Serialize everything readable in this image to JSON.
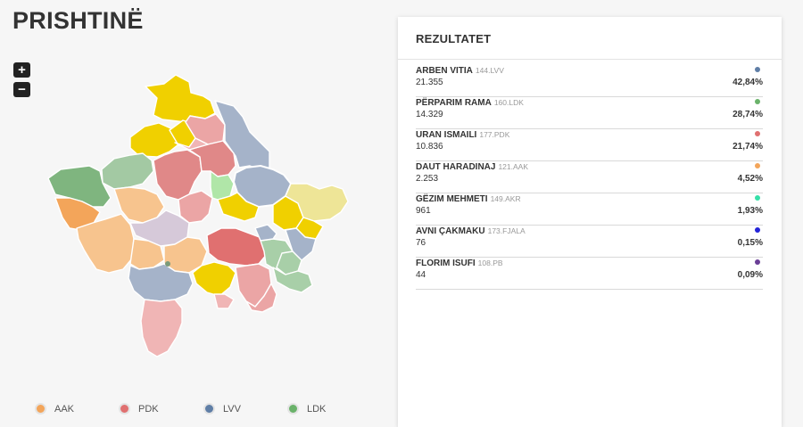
{
  "page": {
    "title": "PRISHTINË"
  },
  "zoom": {
    "in_label": "+",
    "out_label": "−"
  },
  "results": {
    "title": "REZULTATET",
    "candidates": [
      {
        "name": "ARBEN VITIA",
        "list": "144.LVV",
        "votes": "21.355",
        "percent": "42,84%",
        "color": "#5f7ea6"
      },
      {
        "name": "PËRPARIM RAMA",
        "list": "160.LDK",
        "votes": "14.329",
        "percent": "28,74%",
        "color": "#6ab26a"
      },
      {
        "name": "URAN ISMAILI",
        "list": "177.PDK",
        "votes": "10.836",
        "percent": "21,74%",
        "color": "#e07070"
      },
      {
        "name": "DAUT HARADINAJ",
        "list": "121.AAK",
        "votes": "2.253",
        "percent": "4,52%",
        "color": "#f3a55a"
      },
      {
        "name": "GËZIM MEHMETI",
        "list": "149.AKR",
        "votes": "961",
        "percent": "1,93%",
        "color": "#35e0a8"
      },
      {
        "name": "AVNI ÇAKMAKU",
        "list": "173.FJALA",
        "votes": "76",
        "percent": "0,15%",
        "color": "#2424d8"
      },
      {
        "name": "FLORIM ISUFI",
        "list": "108.PB",
        "votes": "44",
        "percent": "0,09%",
        "color": "#6a3e96"
      }
    ]
  },
  "legend": [
    {
      "label": "AAK",
      "color": "#f3a55a"
    },
    {
      "label": "PDK",
      "color": "#e07070"
    },
    {
      "label": "LVV",
      "color": "#5f7ea6"
    },
    {
      "label": "LDK",
      "color": "#6ab26a"
    }
  ]
}
